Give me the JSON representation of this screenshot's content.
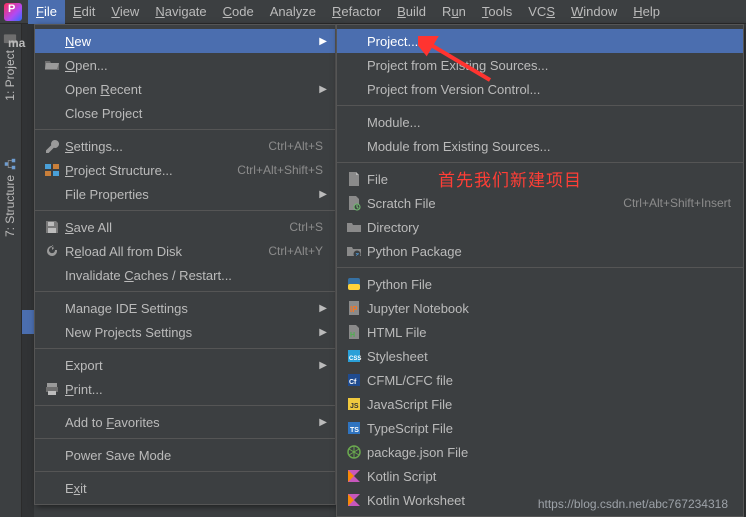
{
  "menubar": {
    "items": [
      {
        "label": "File",
        "mn": "F"
      },
      {
        "label": "Edit",
        "mn": "E"
      },
      {
        "label": "View",
        "mn": "V"
      },
      {
        "label": "Navigate",
        "mn": "N"
      },
      {
        "label": "Code",
        "mn": "C"
      },
      {
        "label": "Analyze"
      },
      {
        "label": "Refactor",
        "mn": "R"
      },
      {
        "label": "Build",
        "mn": "B"
      },
      {
        "label": "Run",
        "mn": "u",
        "mnIndex": 1
      },
      {
        "label": "Tools",
        "mn": "T"
      },
      {
        "label": "VCS",
        "mn": "S",
        "mnIndex": 2
      },
      {
        "label": "Window",
        "mn": "W"
      },
      {
        "label": "Help",
        "mn": "H"
      }
    ],
    "openIndex": 0
  },
  "leftTabs": {
    "project": "1: Project",
    "structure": "7: Structure"
  },
  "bgHint": "ma",
  "fileMenu": [
    {
      "type": "item",
      "label": "New",
      "mn": "N",
      "submenu": true,
      "highlighted": true
    },
    {
      "type": "item",
      "label": "Open...",
      "mn": "O",
      "icon": "folder-open-icon"
    },
    {
      "type": "item",
      "label": "Open Recent",
      "mn": "R",
      "mnIndex": 5,
      "submenu": true
    },
    {
      "type": "item",
      "label": "Close Project"
    },
    {
      "type": "sep"
    },
    {
      "type": "item",
      "label": "Settings...",
      "mn": "S",
      "shortcut": "Ctrl+Alt+S",
      "icon": "wrench-icon"
    },
    {
      "type": "item",
      "label": "Project Structure...",
      "mn": "P",
      "shortcut": "Ctrl+Alt+Shift+S",
      "icon": "project-structure-icon"
    },
    {
      "type": "item",
      "label": "File Properties",
      "submenu": true
    },
    {
      "type": "sep"
    },
    {
      "type": "item",
      "label": "Save All",
      "mn": "S",
      "shortcut": "Ctrl+S",
      "icon": "save-icon"
    },
    {
      "type": "item",
      "label": "Reload All from Disk",
      "mn": "e",
      "mnIndex": 1,
      "shortcut": "Ctrl+Alt+Y",
      "icon": "reload-icon"
    },
    {
      "type": "item",
      "label": "Invalidate Caches / Restart...",
      "mn": "a",
      "mnIndex": 11
    },
    {
      "type": "sep"
    },
    {
      "type": "item",
      "label": "Manage IDE Settings",
      "submenu": true
    },
    {
      "type": "item",
      "label": "New Projects Settings",
      "submenu": true
    },
    {
      "type": "sep"
    },
    {
      "type": "item",
      "label": "Export",
      "submenu": true
    },
    {
      "type": "item",
      "label": "Print...",
      "mn": "P",
      "icon": "print-icon"
    },
    {
      "type": "sep"
    },
    {
      "type": "item",
      "label": "Add to Favorites",
      "mn": "F",
      "mnIndex": 7,
      "submenu": true
    },
    {
      "type": "sep"
    },
    {
      "type": "item",
      "label": "Power Save Mode"
    },
    {
      "type": "sep"
    },
    {
      "type": "item",
      "label": "Exit",
      "mn": "x",
      "mnIndex": 1
    }
  ],
  "newSubmenu": [
    {
      "type": "item",
      "label": "Project...",
      "highlighted": true
    },
    {
      "type": "item",
      "label": "Project from Existing Sources..."
    },
    {
      "type": "item",
      "label": "Project from Version Control..."
    },
    {
      "type": "sep"
    },
    {
      "type": "item",
      "label": "Module..."
    },
    {
      "type": "item",
      "label": "Module from Existing Sources..."
    },
    {
      "type": "sep"
    },
    {
      "type": "item",
      "label": "File",
      "icon": "file-icon"
    },
    {
      "type": "item",
      "label": "Scratch File",
      "shortcut": "Ctrl+Alt+Shift+Insert",
      "icon": "scratch-file-icon"
    },
    {
      "type": "item",
      "label": "Directory",
      "icon": "folder-icon"
    },
    {
      "type": "item",
      "label": "Python Package",
      "icon": "python-package-icon"
    },
    {
      "type": "sep"
    },
    {
      "type": "item",
      "label": "Python File",
      "icon": "python-file-icon"
    },
    {
      "type": "item",
      "label": "Jupyter Notebook",
      "icon": "jupyter-icon"
    },
    {
      "type": "item",
      "label": "HTML File",
      "icon": "html-file-icon"
    },
    {
      "type": "item",
      "label": "Stylesheet",
      "icon": "css-file-icon"
    },
    {
      "type": "item",
      "label": "CFML/CFC file",
      "icon": "cfml-file-icon"
    },
    {
      "type": "item",
      "label": "JavaScript File",
      "icon": "js-file-icon"
    },
    {
      "type": "item",
      "label": "TypeScript File",
      "icon": "ts-file-icon"
    },
    {
      "type": "item",
      "label": "package.json File",
      "icon": "package-json-icon"
    },
    {
      "type": "item",
      "label": "Kotlin Script",
      "icon": "kotlin-icon"
    },
    {
      "type": "item",
      "label": "Kotlin Worksheet",
      "icon": "kotlin-icon"
    }
  ],
  "annotation": {
    "text": "首先我们新建项目",
    "watermark": "https://blog.csdn.net/abc767234318"
  }
}
